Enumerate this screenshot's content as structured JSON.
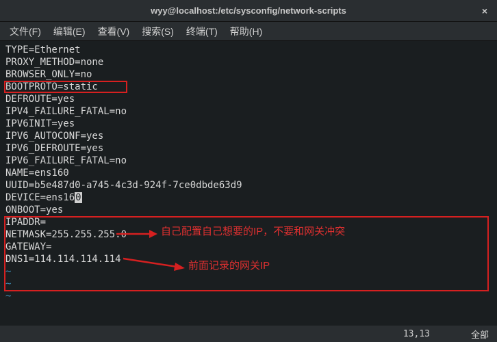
{
  "window": {
    "title": "wyy@localhost:/etc/sysconfig/network-scripts"
  },
  "menu": {
    "file": "文件(F)",
    "edit": "编辑(E)",
    "view": "查看(V)",
    "search": "搜索(S)",
    "terminal": "终端(T)",
    "help": "帮助(H)"
  },
  "content": {
    "l01": "TYPE=Ethernet",
    "l02": "PROXY_METHOD=none",
    "l03": "BROWSER_ONLY=no",
    "l04": "BOOTPROTO=static",
    "l05": "DEFROUTE=yes",
    "l06": "IPV4_FAILURE_FATAL=no",
    "l07": "IPV6INIT=yes",
    "l08": "IPV6_AUTOCONF=yes",
    "l09": "IPV6_DEFROUTE=yes",
    "l10": "IPV6_FAILURE_FATAL=no",
    "l11": "NAME=ens160",
    "l12": "UUID=b5e487d0-a745-4c3d-924f-7ce0dbde63d9",
    "l13a": "DEVICE=ens16",
    "l13b": "0",
    "l14": "ONBOOT=yes",
    "l15": "IPADDR=",
    "l16": "NETMASK=255.255.255.0",
    "l17": "GATEWAY=",
    "l18": "DNS1=114.114.114.114",
    "tilde": "~"
  },
  "annot": {
    "a1": "自己配置自己想要的IP，不要和网关冲突",
    "a2": "前面记录的网关IP"
  },
  "status": {
    "pos": "13,13",
    "all": "全部"
  }
}
